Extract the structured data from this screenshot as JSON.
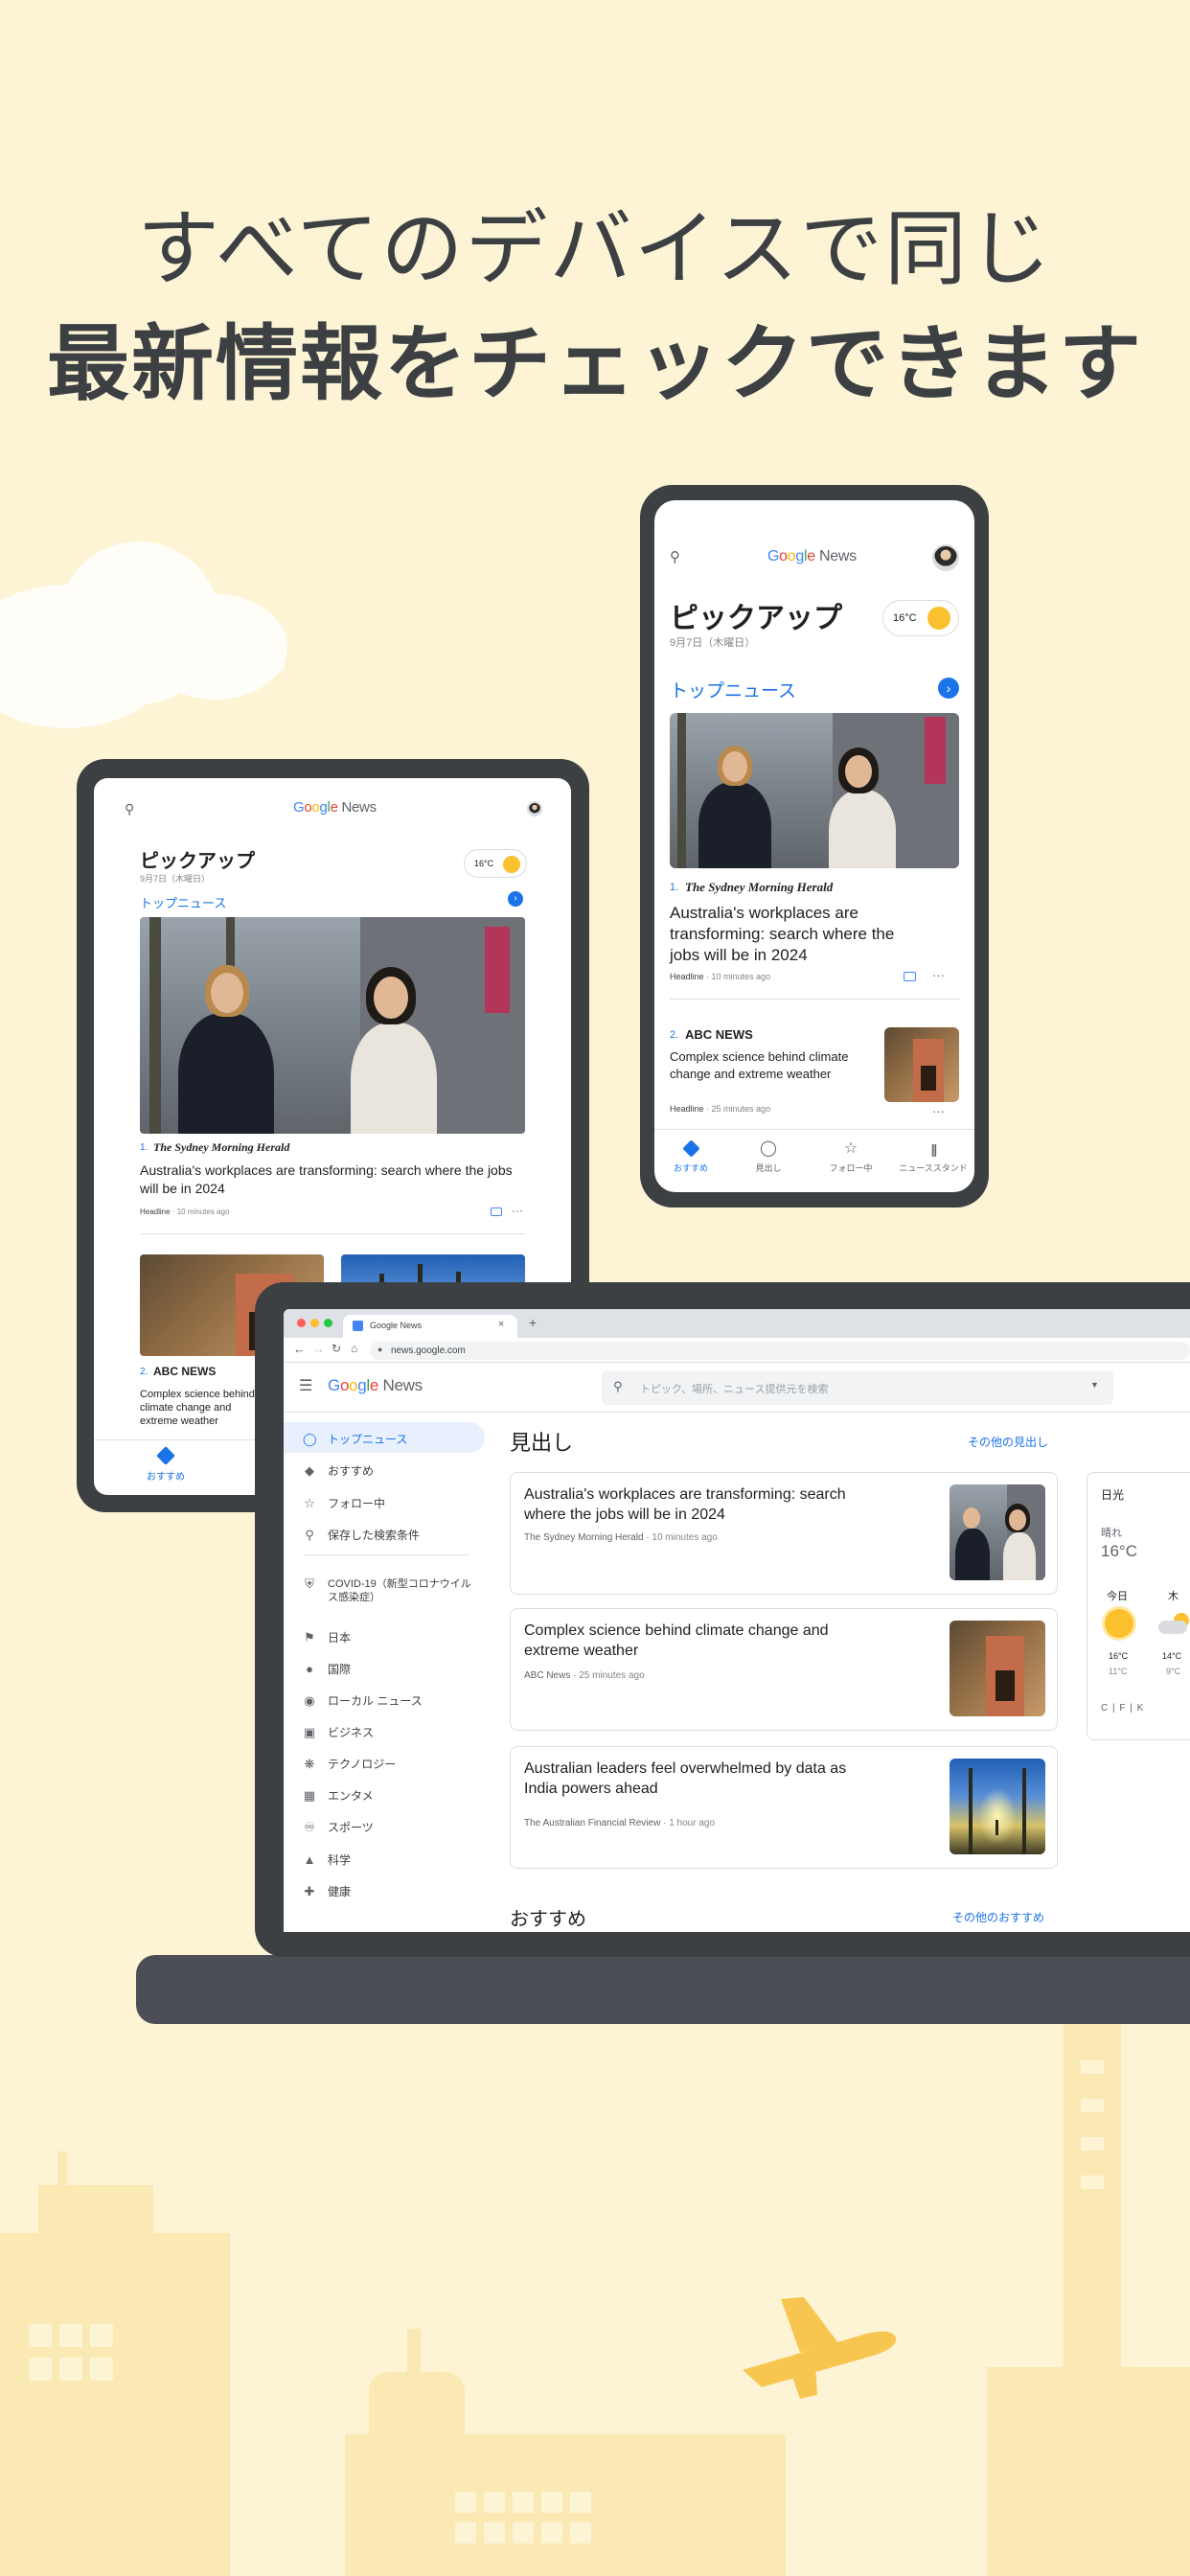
{
  "headline": {
    "line1": "すべてのデバイスで同じ",
    "line2": "最新情報をチェックできます"
  },
  "brand": {
    "google": "Google",
    "news": "News"
  },
  "phone": {
    "title": "ピックアップ",
    "date": "9月7日（木曜日）",
    "temp": "16°C",
    "section": "トップニュース",
    "story1": {
      "rank": "1.",
      "source": "The Sydney Morning Herald",
      "headline": "Australia's workplaces are transforming: search where the jobs will be in 2024",
      "meta_type": "Headline",
      "meta_time": "10 minutes ago"
    },
    "story2": {
      "rank": "2.",
      "source": "ABC NEWS",
      "headline": "Complex science behind climate change and extreme weather",
      "meta_type": "Headline",
      "meta_time": "25 minutes ago"
    },
    "nav": [
      "おすすめ",
      "見出し",
      "フォロー中",
      "ニューススタンド"
    ]
  },
  "tablet": {
    "title": "ピックアップ",
    "date": "9月7日（木曜日）",
    "temp": "16°C",
    "section": "トップニュース",
    "story1": {
      "rank": "1.",
      "source": "The Sydney Morning Herald",
      "headline": "Australia's workplaces are transforming: search where the jobs will be in 2024",
      "meta_type": "Headline",
      "meta_time": "10 minutes ago"
    },
    "story2": {
      "rank": "2.",
      "source": "ABC NEWS",
      "headline": "Complex science behind climate change and extreme weather"
    },
    "nav_active": "おすすめ"
  },
  "laptop": {
    "tab_title": "Google News",
    "url": "news.google.com",
    "search_placeholder": "トピック、場所、ニュース提供元を検索",
    "sidebar": [
      {
        "label": "トップニュース",
        "icon": "globe-icon",
        "active": true
      },
      {
        "label": "おすすめ",
        "icon": "diamond-icon"
      },
      {
        "label": "フォロー中",
        "icon": "star-icon"
      },
      {
        "label": "保存した検索条件",
        "icon": "search-icon"
      },
      {
        "label": "COVID-19（新型コロナウイルス感染症）",
        "icon": "shield-icon"
      },
      {
        "label": "日本",
        "icon": "flag-icon"
      },
      {
        "label": "国際",
        "icon": "world-icon"
      },
      {
        "label": "ローカル ニュース",
        "icon": "pin-icon"
      },
      {
        "label": "ビジネス",
        "icon": "building-icon"
      },
      {
        "label": "テクノロジー",
        "icon": "chip-icon"
      },
      {
        "label": "エンタメ",
        "icon": "film-icon"
      },
      {
        "label": "スポーツ",
        "icon": "bike-icon"
      },
      {
        "label": "科学",
        "icon": "flask-icon"
      },
      {
        "label": "健康",
        "icon": "health-icon"
      }
    ],
    "section_title": "見出し",
    "section_more": "その他の見出し",
    "stories": [
      {
        "headline": "Australia's workplaces are transforming: search where the jobs will be in 2024",
        "source": "The Sydney Morning Herald",
        "time": "10 minutes ago"
      },
      {
        "headline": "Complex science behind climate change and extreme weather",
        "source": "ABC News",
        "time": "25 minutes ago"
      },
      {
        "headline": "Australian leaders feel overwhelmed by data as India powers ahead",
        "source": "The Australian Financial Review",
        "time": "1 hour ago"
      }
    ],
    "rec_title": "おすすめ",
    "rec_more": "その他のおすすめ",
    "weather": {
      "location": "日光",
      "condition": "晴れ",
      "temp": "16°C",
      "today_label": "今日",
      "next_label": "木",
      "today_hi": "16°C",
      "today_lo": "11°C",
      "next_hi": "14°C",
      "next_lo": "9°C",
      "units": "C | F | K"
    }
  }
}
